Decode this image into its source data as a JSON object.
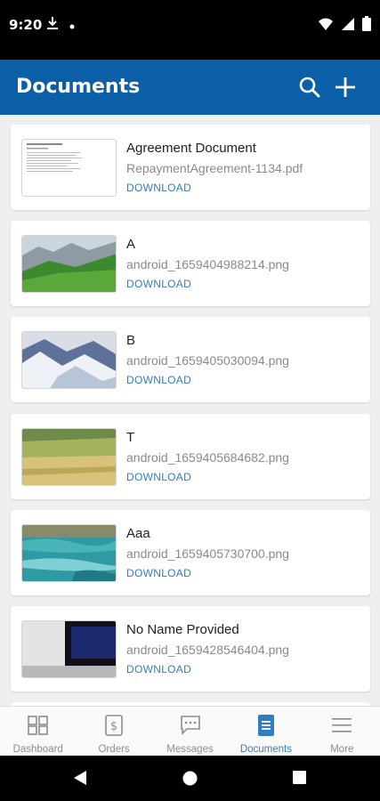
{
  "status": {
    "time": "9:20"
  },
  "app_bar": {
    "title": "Documents",
    "search_icon": "search-icon",
    "add_icon": "add-icon",
    "color": "#0b5fa6"
  },
  "documents": [
    {
      "title": "Agreement Document",
      "file": "RepaymentAgreement-1134.pdf",
      "action": "DOWNLOAD",
      "thumb": "pdf-page"
    },
    {
      "title": "A",
      "file": "android_1659404988214.png",
      "action": "DOWNLOAD",
      "thumb": "mountain-meadow"
    },
    {
      "title": "B",
      "file": "android_1659405030094.png",
      "action": "DOWNLOAD",
      "thumb": "snowy-mountains"
    },
    {
      "title": "T",
      "file": "android_1659405684682.png",
      "action": "DOWNLOAD",
      "thumb": "grass-field"
    },
    {
      "title": "Aaa",
      "file": "android_1659405730700.png",
      "action": "DOWNLOAD",
      "thumb": "ocean-waves"
    },
    {
      "title": "No Name Provided",
      "file": "android_1659428546404.png",
      "action": "DOWNLOAD",
      "thumb": "room-monitor"
    }
  ],
  "bottom_nav": [
    {
      "label": "Dashboard",
      "icon": "dashboard-icon",
      "active": false
    },
    {
      "label": "Orders",
      "icon": "orders-icon",
      "active": false
    },
    {
      "label": "Messages",
      "icon": "messages-icon",
      "active": false
    },
    {
      "label": "Documents",
      "icon": "documents-icon",
      "active": true
    },
    {
      "label": "More",
      "icon": "menu-icon",
      "active": false
    }
  ],
  "accent_color": "#2f7ec2"
}
